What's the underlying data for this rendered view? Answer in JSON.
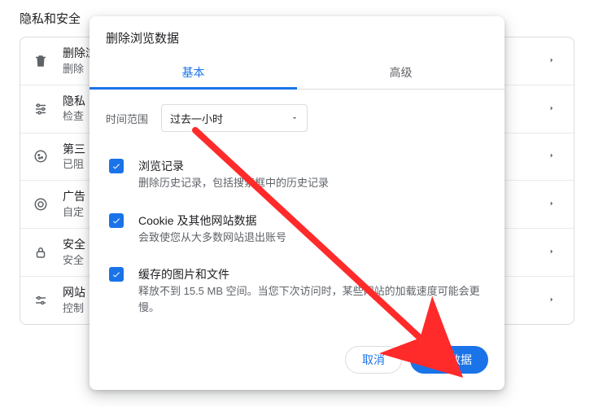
{
  "section": {
    "title": "隐私和安全"
  },
  "rows": [
    {
      "title": "删除浏览数据",
      "sub": "删除"
    },
    {
      "title": "隐私",
      "sub": "检查"
    },
    {
      "title": "第三",
      "sub": "已阻"
    },
    {
      "title": "广告",
      "sub": "自定"
    },
    {
      "title": "安全",
      "sub": "安全"
    },
    {
      "title": "网站",
      "sub": "控制"
    }
  ],
  "dialog": {
    "title": "删除浏览数据",
    "tabs": {
      "basic": "基本",
      "advanced": "高级"
    },
    "time": {
      "label": "时间范围",
      "value": "过去一小时"
    },
    "items": [
      {
        "title": "浏览记录",
        "sub": "删除历史记录，包括搜索框中的历史记录"
      },
      {
        "title": "Cookie 及其他网站数据",
        "sub": "会致使您从大多数网站退出账号"
      },
      {
        "title": "缓存的图片和文件",
        "sub": "释放不到 15.5 MB 空间。当您下次访问时，某些网站的加载速度可能会更慢。"
      }
    ],
    "cancel": "取消",
    "confirm": "删除数据"
  }
}
